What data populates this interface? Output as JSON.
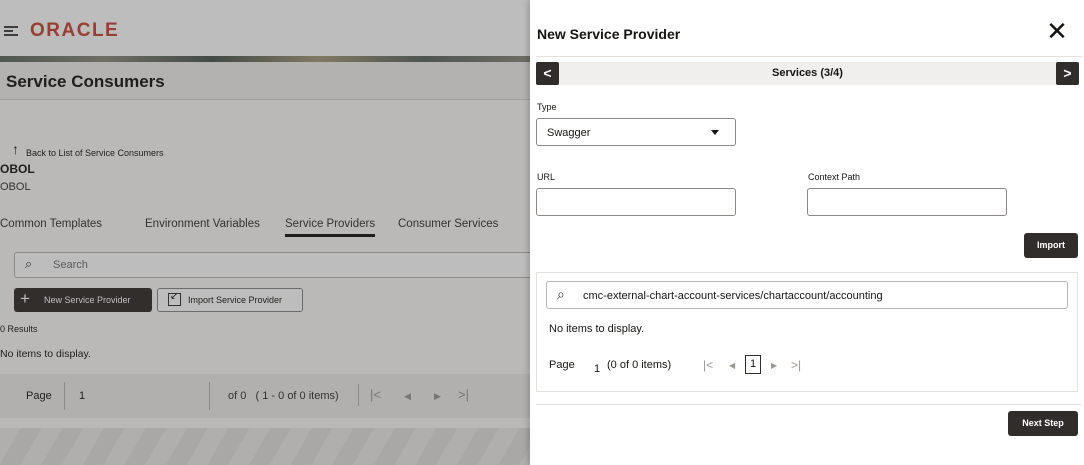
{
  "background": {
    "brand": "ORACLE",
    "page_title": "Service Consumers",
    "back_link": "Back to List of Service Consumers",
    "consumer_name": "OBOL",
    "consumer_sub": "OBOL",
    "tabs": [
      {
        "label": "Common Templates"
      },
      {
        "label": "Environment Variables"
      },
      {
        "label": "Service Providers"
      },
      {
        "label": "Consumer Services"
      }
    ],
    "search_placeholder": "Search",
    "new_button": "New Service Provider",
    "import_button": "Import Service Provider",
    "results": "0 Results",
    "no_items": "No items to display.",
    "pager": {
      "label": "Page",
      "value": "1",
      "of_text": "of 0",
      "range_text": "( 1 - 0 of 0 items)"
    }
  },
  "drawer": {
    "title": "New Service Provider",
    "close_icon": "close-icon",
    "step_label": "Services (3/4)",
    "type_label": "Type",
    "type_value": "Swagger",
    "url_label": "URL",
    "url_value": "",
    "context_label": "Context Path",
    "context_value": "",
    "import_button": "Import",
    "search_value": "cmc-external-chart-account-services/chartaccount/accounting",
    "no_items": "No items to display.",
    "pager": {
      "label": "Page",
      "page_num": "1",
      "count_text": "(0 of 0 items)",
      "current": "1"
    },
    "next_step_button": "Next Step"
  },
  "colors": {
    "brand": "#c74634",
    "dark_button": "#312d2a",
    "overlay": "rgba(50,50,50,0.32)"
  }
}
